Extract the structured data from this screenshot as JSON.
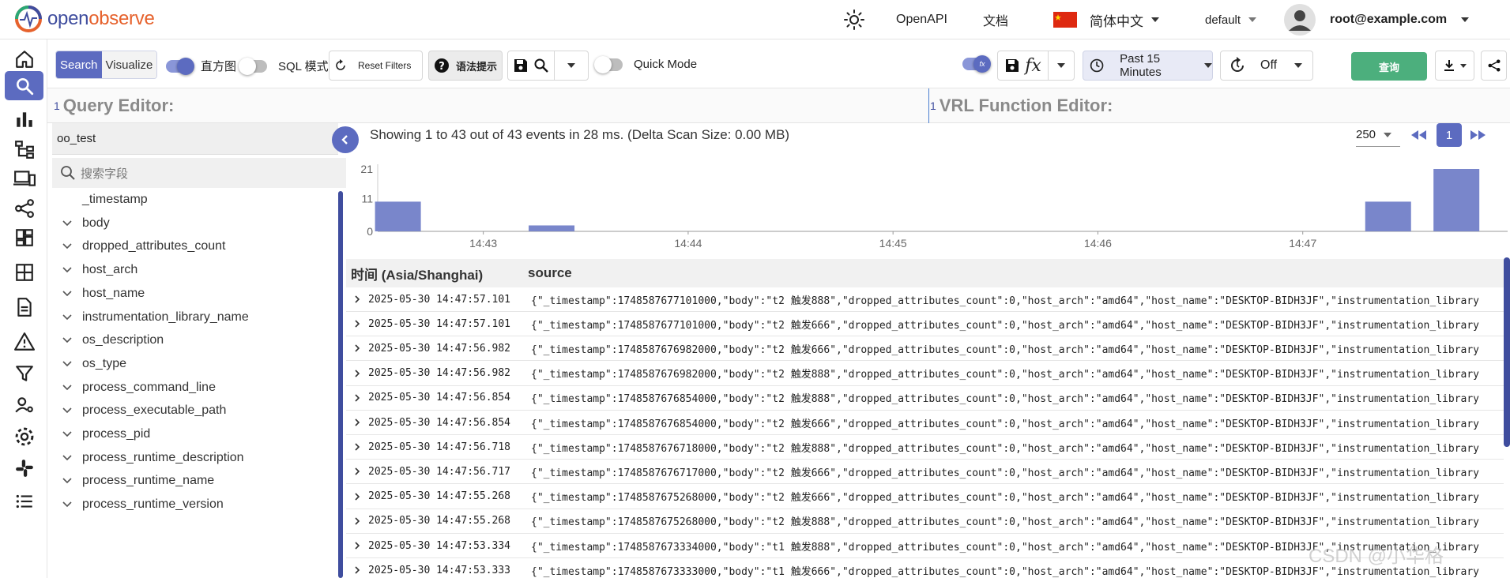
{
  "app": {
    "logo_open": "open",
    "logo_observe": "observe",
    "theme_icon": "sun-icon",
    "nav_openapi": "OpenAPI",
    "nav_docs": "文档",
    "language": "简体中文",
    "org": "default",
    "user": "root@example.com"
  },
  "sidebar": [
    {
      "id": "home",
      "icon": "home-icon",
      "active": false
    },
    {
      "id": "logs",
      "icon": "search-icon",
      "active": true
    },
    {
      "id": "metrics",
      "icon": "bar-chart-icon",
      "active": false
    },
    {
      "id": "traces",
      "icon": "hierarchy-icon",
      "active": false
    },
    {
      "id": "rum",
      "icon": "devices-icon",
      "active": false
    },
    {
      "id": "pipelines",
      "icon": "share-icon",
      "active": false
    },
    {
      "id": "dashboards",
      "icon": "dashboard-icon",
      "active": false
    },
    {
      "id": "streams",
      "icon": "grid-icon",
      "active": false
    },
    {
      "id": "reports",
      "icon": "document-icon",
      "active": false
    },
    {
      "id": "alerts",
      "icon": "alert-icon",
      "active": false
    },
    {
      "id": "filters",
      "icon": "filter-icon",
      "active": false
    },
    {
      "id": "iam",
      "icon": "user-settings-icon",
      "active": false
    },
    {
      "id": "settings",
      "icon": "gear-icon",
      "active": false
    },
    {
      "id": "slack",
      "icon": "slack-icon",
      "active": false
    },
    {
      "id": "more",
      "icon": "list-icon",
      "active": false
    }
  ],
  "toolbar": {
    "search_tab": "Search",
    "visualize_tab": "Visualize",
    "histogram_label": "直方图",
    "histogram_on": true,
    "sql_label": "SQL 模式",
    "sql_on": false,
    "reset_filters": "Reset Filters",
    "syntax_hint": "语法提示",
    "quick_mode": "Quick Mode",
    "quick_mode_on": false,
    "fn_toggle_on": true,
    "time_range": "Past 15 Minutes",
    "refresh": "Off",
    "run_query": "查询",
    "accent": "#5c6bc0",
    "run_color": "#4caf7d"
  },
  "editors": {
    "query_title": "Query Editor:",
    "query_line": "1",
    "vrl_title": "VRL Function Editor:",
    "vrl_line": "1"
  },
  "stream": {
    "selected": "oo_test",
    "search_placeholder": "搜索字段"
  },
  "fields": [
    "_timestamp",
    "body",
    "dropped_attributes_count",
    "host_arch",
    "host_name",
    "instrumentation_library_name",
    "os_description",
    "os_type",
    "process_command_line",
    "process_executable_path",
    "process_pid",
    "process_runtime_description",
    "process_runtime_name",
    "process_runtime_version"
  ],
  "results": {
    "summary": "Showing 1 to 43 out of 43 events in 28 ms. (Delta Scan Size: 0.00 MB)",
    "page_size": "250",
    "current_page": "1",
    "col_time": "时间 (Asia/Shanghai)",
    "col_source": "source"
  },
  "chart_data": {
    "type": "bar",
    "xlabel": "",
    "ylabel": "",
    "y_ticks": [
      "21",
      "11",
      "0"
    ],
    "ylim": [
      0,
      21
    ],
    "x_ticks": [
      "14:43",
      "14:44",
      "14:45",
      "14:46",
      "14:47"
    ],
    "grid": false,
    "bar_color": "#7986cb",
    "bars": [
      {
        "bucket": "14:42:35",
        "value": 10
      },
      {
        "bucket": "14:43:20",
        "value": 2
      },
      {
        "bucket": "14:47:25",
        "value": 10
      },
      {
        "bucket": "14:47:45",
        "value": 21
      }
    ]
  },
  "rows": [
    {
      "ts": "2025-05-30 14:47:57.101",
      "src": "{\"_timestamp\":1748587677101000,\"body\":\"t2 触发888\",\"dropped_attributes_count\":0,\"host_arch\":\"amd64\",\"host_name\":\"DESKTOP-BIDH3JF\",\"instrumentation_library"
    },
    {
      "ts": "2025-05-30 14:47:57.101",
      "src": "{\"_timestamp\":1748587677101000,\"body\":\"t2 触发666\",\"dropped_attributes_count\":0,\"host_arch\":\"amd64\",\"host_name\":\"DESKTOP-BIDH3JF\",\"instrumentation_library"
    },
    {
      "ts": "2025-05-30 14:47:56.982",
      "src": "{\"_timestamp\":1748587676982000,\"body\":\"t2 触发666\",\"dropped_attributes_count\":0,\"host_arch\":\"amd64\",\"host_name\":\"DESKTOP-BIDH3JF\",\"instrumentation_library"
    },
    {
      "ts": "2025-05-30 14:47:56.982",
      "src": "{\"_timestamp\":1748587676982000,\"body\":\"t2 触发888\",\"dropped_attributes_count\":0,\"host_arch\":\"amd64\",\"host_name\":\"DESKTOP-BIDH3JF\",\"instrumentation_library"
    },
    {
      "ts": "2025-05-30 14:47:56.854",
      "src": "{\"_timestamp\":1748587676854000,\"body\":\"t2 触发888\",\"dropped_attributes_count\":0,\"host_arch\":\"amd64\",\"host_name\":\"DESKTOP-BIDH3JF\",\"instrumentation_library"
    },
    {
      "ts": "2025-05-30 14:47:56.854",
      "src": "{\"_timestamp\":1748587676854000,\"body\":\"t2 触发666\",\"dropped_attributes_count\":0,\"host_arch\":\"amd64\",\"host_name\":\"DESKTOP-BIDH3JF\",\"instrumentation_library"
    },
    {
      "ts": "2025-05-30 14:47:56.718",
      "src": "{\"_timestamp\":1748587676718000,\"body\":\"t2 触发888\",\"dropped_attributes_count\":0,\"host_arch\":\"amd64\",\"host_name\":\"DESKTOP-BIDH3JF\",\"instrumentation_library"
    },
    {
      "ts": "2025-05-30 14:47:56.717",
      "src": "{\"_timestamp\":1748587676717000,\"body\":\"t2 触发666\",\"dropped_attributes_count\":0,\"host_arch\":\"amd64\",\"host_name\":\"DESKTOP-BIDH3JF\",\"instrumentation_library"
    },
    {
      "ts": "2025-05-30 14:47:55.268",
      "src": "{\"_timestamp\":1748587675268000,\"body\":\"t2 触发666\",\"dropped_attributes_count\":0,\"host_arch\":\"amd64\",\"host_name\":\"DESKTOP-BIDH3JF\",\"instrumentation_library"
    },
    {
      "ts": "2025-05-30 14:47:55.268",
      "src": "{\"_timestamp\":1748587675268000,\"body\":\"t2 触发888\",\"dropped_attributes_count\":0,\"host_arch\":\"amd64\",\"host_name\":\"DESKTOP-BIDH3JF\",\"instrumentation_library"
    },
    {
      "ts": "2025-05-30 14:47:53.334",
      "src": "{\"_timestamp\":1748587673334000,\"body\":\"t1 触发888\",\"dropped_attributes_count\":0,\"host_arch\":\"amd64\",\"host_name\":\"DESKTOP-BIDH3JF\",\"instrumentation_library"
    },
    {
      "ts": "2025-05-30 14:47:53.333",
      "src": "{\"_timestamp\":1748587673333000,\"body\":\"t1 触发666\",\"dropped_attributes_count\":0,\"host_arch\":\"amd64\",\"host_name\":\"DESKTOP-BIDH3JF\",\"instrumentation_library"
    }
  ],
  "watermark": "CSDN @小华格"
}
